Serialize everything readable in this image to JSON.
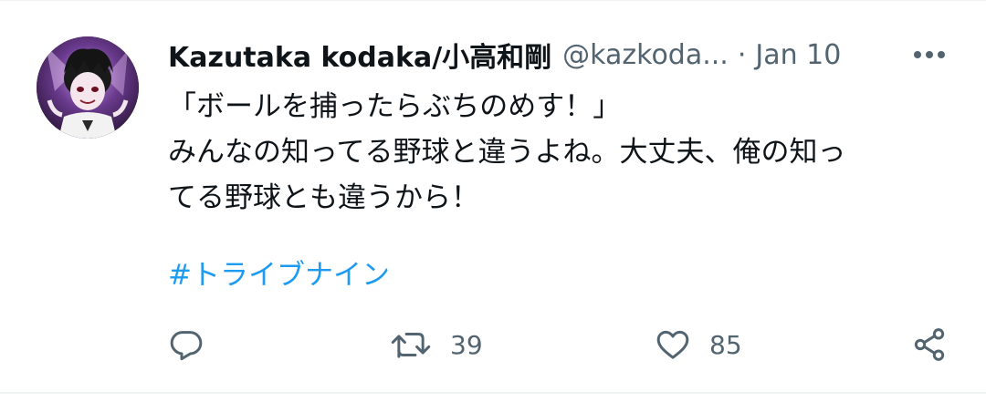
{
  "tweet": {
    "author_name": "Kazutaka kodaka/小高和剛",
    "handle": "@kazkoda...",
    "separator": "·",
    "date": "Jan 10",
    "lines": [
      "「ボールを捕ったらぶちのめす！」",
      "みんなの知ってる野球と違うよね。大丈夫、俺の知っ",
      "てる野球とも違うから！"
    ],
    "hashtag": "#トライブナイン"
  },
  "actions": {
    "reply_icon": "reply-icon",
    "retweet_icon": "retweet-icon",
    "retweet_count": "39",
    "like_icon": "heart-icon",
    "like_count": "85",
    "share_icon": "share-icon"
  },
  "colors": {
    "text": "#0f1419",
    "secondary": "#536471",
    "link": "#1d9bf0"
  }
}
